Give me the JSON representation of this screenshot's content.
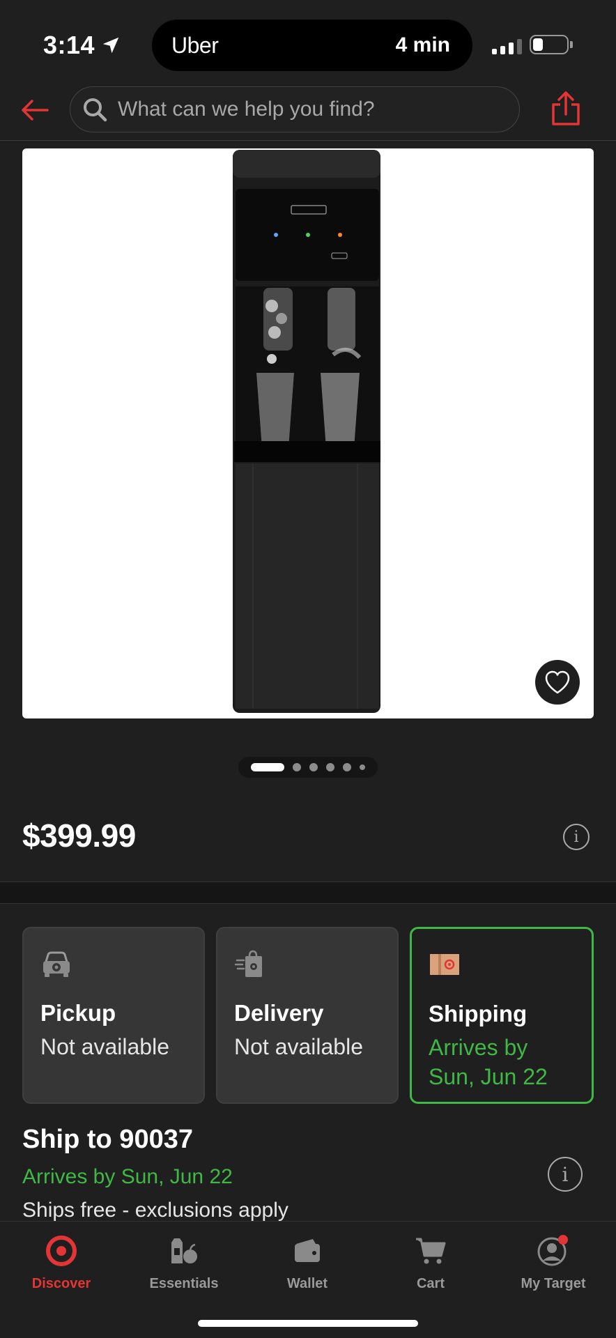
{
  "status_bar": {
    "time": "3:14",
    "live_activity_app": "Uber",
    "live_activity_eta": "4 min"
  },
  "top_nav": {
    "search_placeholder": "What can we help you find?"
  },
  "gallery": {
    "image_count": 6,
    "active_index": 0
  },
  "product": {
    "price": "$399.99"
  },
  "fulfillment": [
    {
      "title": "Pickup",
      "subtitle": "Not available",
      "selected": false
    },
    {
      "title": "Delivery",
      "subtitle": "Not available",
      "selected": false
    },
    {
      "title": "Shipping",
      "subtitle": "Arrives by Sun, Jun 22",
      "selected": true
    }
  ],
  "shipping": {
    "ship_to": "Ship to 90037",
    "arrives": "Arrives by Sun, Jun 22",
    "note": "Ships free - exclusions apply"
  },
  "tabs": [
    {
      "label": "Discover",
      "active": true
    },
    {
      "label": "Essentials",
      "active": false
    },
    {
      "label": "Wallet",
      "active": false
    },
    {
      "label": "Cart",
      "active": false
    },
    {
      "label": "My Target",
      "active": false
    }
  ],
  "colors": {
    "accent": "#e33535",
    "success": "#3fb846",
    "background": "#1f1f1f"
  }
}
